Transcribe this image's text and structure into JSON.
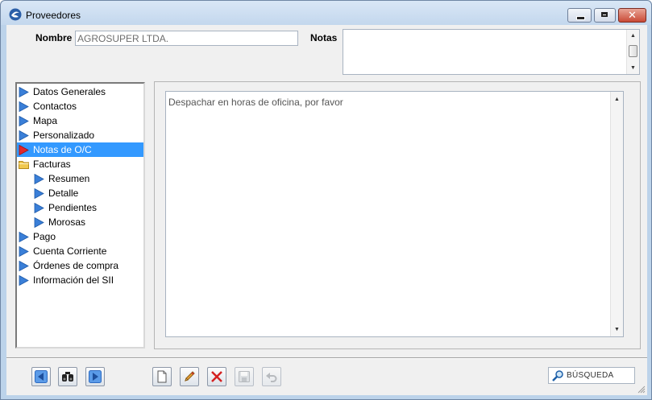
{
  "window": {
    "title": "Proveedores",
    "controls": [
      "minimize",
      "maximize",
      "close"
    ]
  },
  "form": {
    "nombre_label": "Nombre",
    "nombre_value": "AGROSUPER LTDA.",
    "notas_label": "Notas",
    "notas_value": ""
  },
  "tree": {
    "items": [
      {
        "label": "Datos Generales",
        "icon": "arrow-icon",
        "level": 0
      },
      {
        "label": "Contactos",
        "icon": "arrow-icon",
        "level": 0
      },
      {
        "label": "Mapa",
        "icon": "arrow-icon",
        "level": 0
      },
      {
        "label": "Personalizado",
        "icon": "arrow-icon",
        "level": 0
      },
      {
        "label": "Notas de O/C",
        "icon": "red-arrow-icon",
        "level": 0,
        "selected": true
      },
      {
        "label": "Facturas",
        "icon": "folder-icon",
        "level": 0
      },
      {
        "label": "Resumen",
        "icon": "arrow-icon",
        "level": 1
      },
      {
        "label": "Detalle",
        "icon": "arrow-icon",
        "level": 1
      },
      {
        "label": "Pendientes",
        "icon": "arrow-icon",
        "level": 1
      },
      {
        "label": "Morosas",
        "icon": "arrow-icon",
        "level": 1
      },
      {
        "label": "Pago",
        "icon": "arrow-icon",
        "level": 0
      },
      {
        "label": "Cuenta Corriente",
        "icon": "arrow-icon",
        "level": 0
      },
      {
        "label": "Órdenes de compra",
        "icon": "arrow-icon",
        "level": 0
      },
      {
        "label": "Información del SII",
        "icon": "arrow-icon",
        "level": 0
      }
    ]
  },
  "content": {
    "note_text": "Despachar en horas de oficina, por favor"
  },
  "toolbar": {
    "buttons": [
      "previous-icon",
      "binoculars-icon",
      "next-icon",
      "new-document-icon",
      "edit-pencil-icon",
      "delete-icon",
      "save-icon",
      "undo-icon"
    ]
  },
  "search": {
    "label": "BÚSQUEDA"
  },
  "colors": {
    "selection": "#3399ff",
    "arrow": "#3a7fd8",
    "selected_arrow": "#e0282e",
    "folder": "#f0c850",
    "titlebar": "#c8dbef"
  }
}
